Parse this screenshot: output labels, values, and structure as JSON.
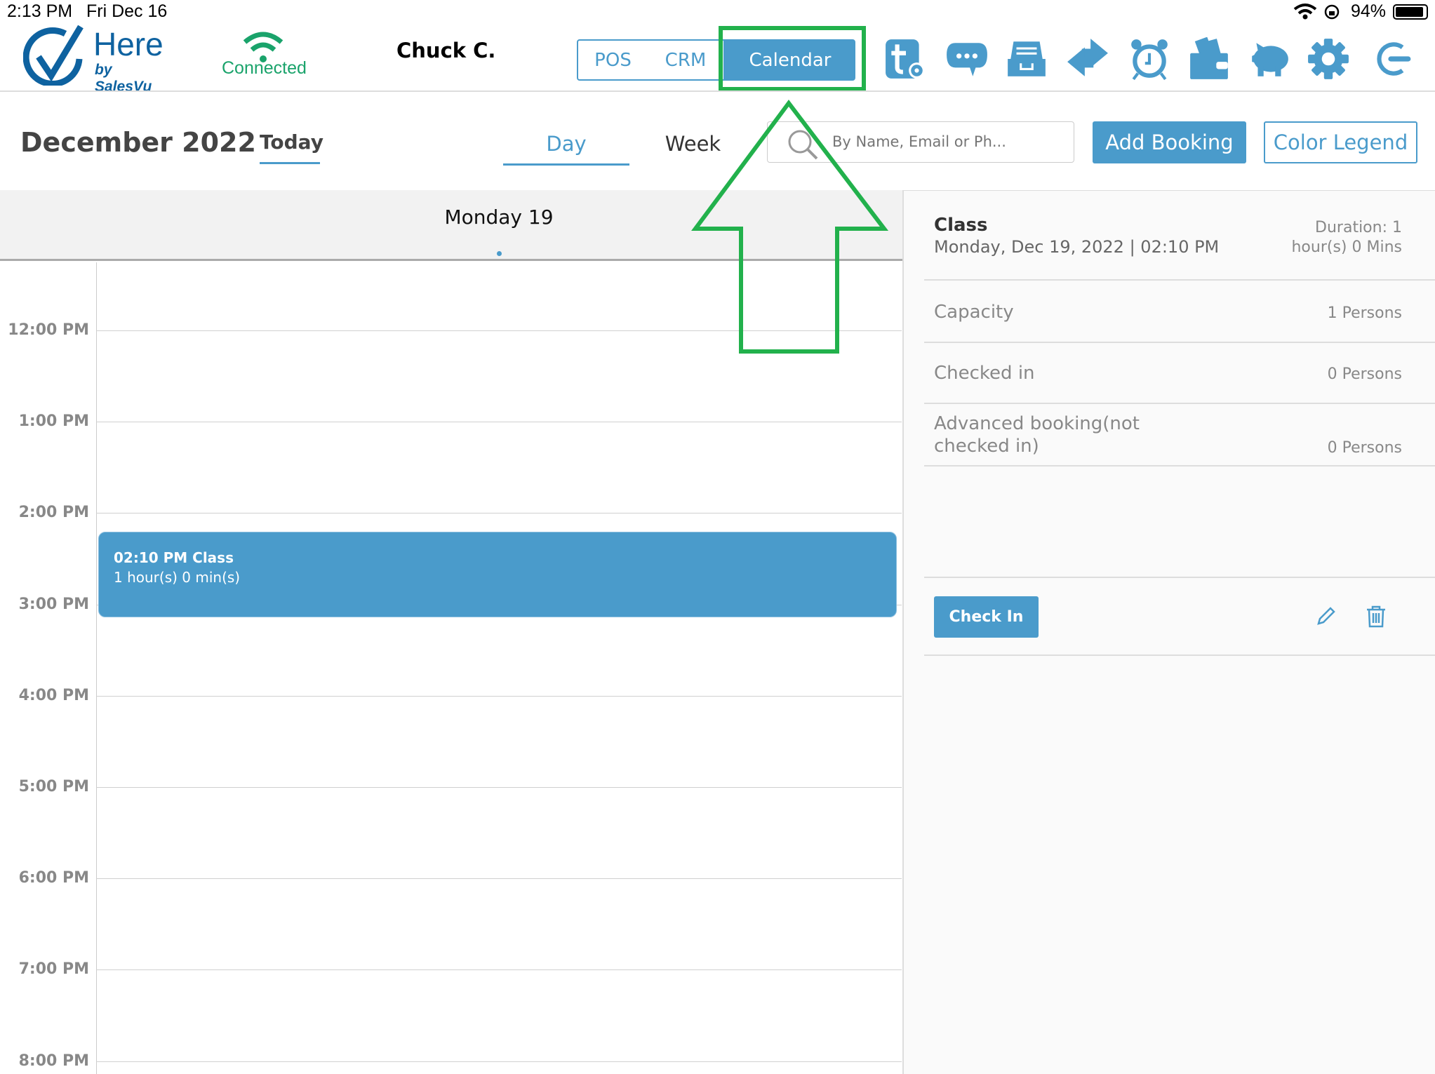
{
  "status_bar": {
    "time": "2:13 PM",
    "date": "Fri Dec 16",
    "battery": "94%"
  },
  "header": {
    "logo_main": "Here",
    "logo_sub": "by SalesVu",
    "connection": "Connected",
    "user": "Chuck C.",
    "tabs": [
      {
        "label": "POS"
      },
      {
        "label": "CRM"
      },
      {
        "label": "Calendar",
        "active": true
      }
    ],
    "icons": [
      "tip-settings-icon",
      "chat-icon",
      "cash-drawer-icon",
      "transfer-arrows-icon",
      "alarm-clock-icon",
      "wallet-icon",
      "piggy-bank-icon",
      "gear-icon",
      "logout-icon"
    ]
  },
  "toolbar": {
    "month": "December 2022",
    "today": "Today",
    "views": [
      "Day",
      "Week"
    ],
    "active_view": "Day",
    "search_placeholder": "By Name, Email or Ph...",
    "add_booking": "Add Booking",
    "color_legend": "Color Legend"
  },
  "calendar": {
    "day_header": "Monday 19",
    "hours": [
      "12:00 PM",
      "1:00 PM",
      "2:00 PM",
      "3:00 PM",
      "4:00 PM",
      "5:00 PM",
      "6:00 PM",
      "7:00 PM",
      "8:00 PM"
    ],
    "event": {
      "title": "02:10 PM Class",
      "duration": "1 hour(s) 0 min(s)"
    }
  },
  "details": {
    "title": "Class",
    "datetime": "Monday, Dec 19, 2022 | 02:10 PM",
    "duration_1": "Duration: 1",
    "duration_2": "hour(s) 0 Mins",
    "rows": [
      {
        "label": "Capacity",
        "value": "1 Persons"
      },
      {
        "label": "Checked in",
        "value": "0 Persons"
      },
      {
        "label": "Advanced booking(not",
        "label2": "checked in)",
        "value": "0 Persons"
      }
    ],
    "check_in": "Check In"
  },
  "colors": {
    "accent": "#4a9bcb",
    "connected": "#1aa36b",
    "annotation": "#22b14c"
  }
}
